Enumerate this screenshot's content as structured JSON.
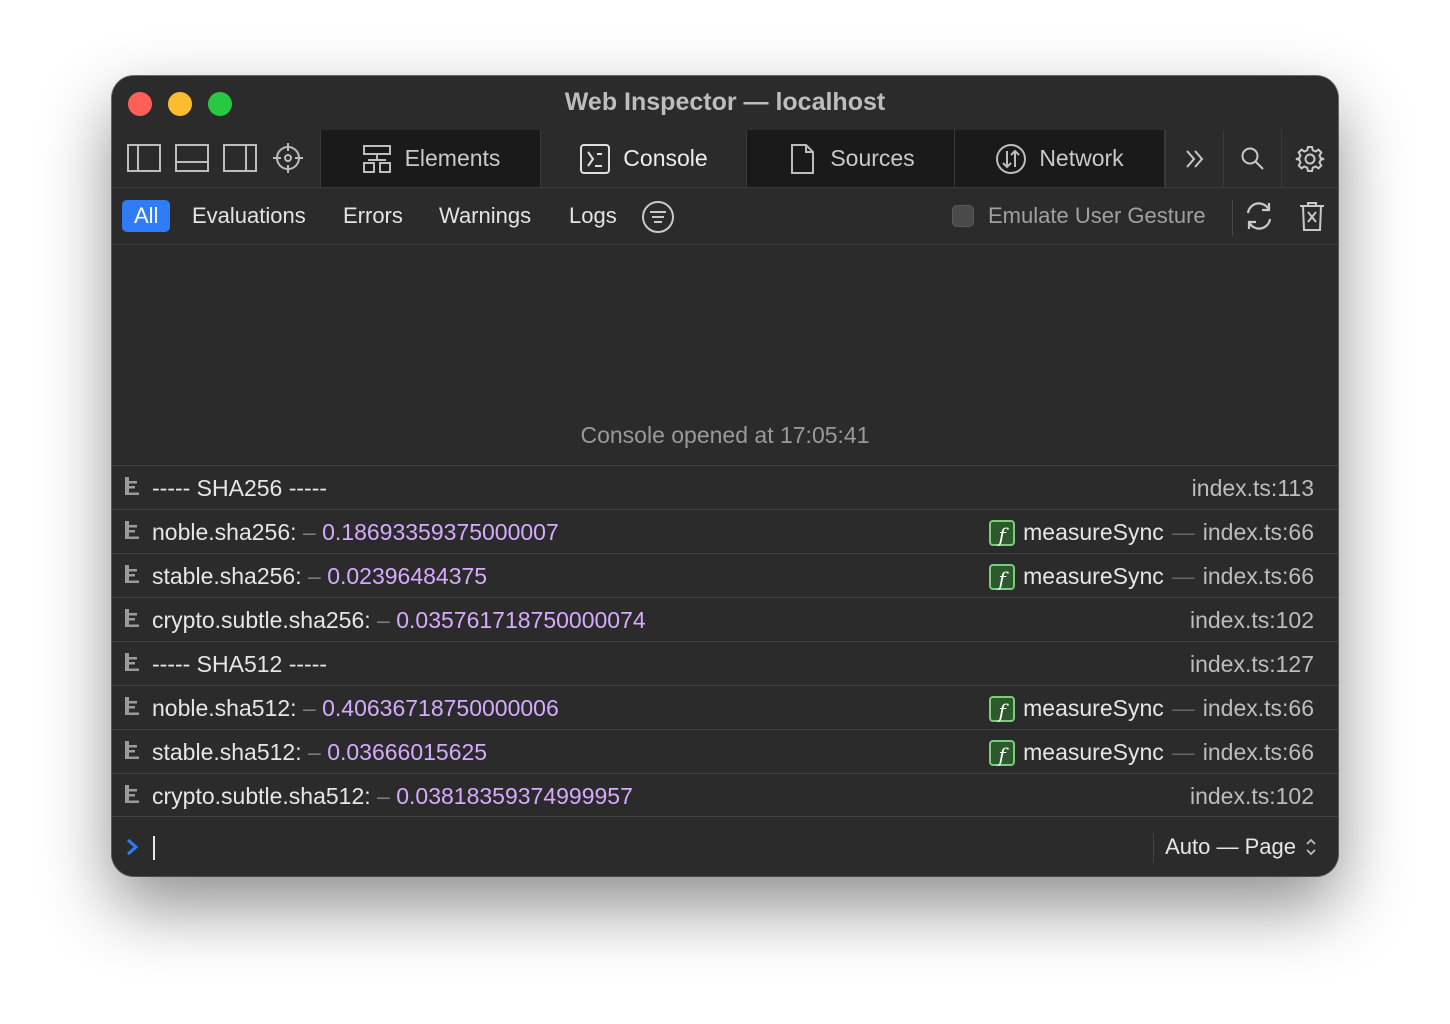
{
  "window": {
    "title": "Web Inspector — localhost"
  },
  "tabs": [
    {
      "label": "Elements",
      "icon": "elements-icon",
      "active": false
    },
    {
      "label": "Console",
      "icon": "console-icon",
      "active": true
    },
    {
      "label": "Sources",
      "icon": "sources-icon",
      "active": false
    },
    {
      "label": "Network",
      "icon": "network-icon",
      "active": false
    }
  ],
  "filters": [
    {
      "label": "All",
      "active": true
    },
    {
      "label": "Evaluations",
      "active": false
    },
    {
      "label": "Errors",
      "active": false
    },
    {
      "label": "Warnings",
      "active": false
    },
    {
      "label": "Logs",
      "active": false
    }
  ],
  "toolbar": {
    "emulate_label": "Emulate User Gesture",
    "emulate_checked": false
  },
  "console": {
    "opened_text": "Console opened at 17:05:41",
    "messages": [
      {
        "text": "----- SHA256 -----",
        "dash": "",
        "value": "",
        "function": "",
        "sep": "",
        "location": "index.ts:113"
      },
      {
        "text": "noble.sha256:",
        "dash": "–",
        "value": "0.18693359375000007",
        "function": "measureSync",
        "sep": "—",
        "location": "index.ts:66"
      },
      {
        "text": "stable.sha256:",
        "dash": "–",
        "value": "0.02396484375",
        "function": "measureSync",
        "sep": "—",
        "location": "index.ts:66"
      },
      {
        "text": "crypto.subtle.sha256:",
        "dash": "–",
        "value": "0.035761718750000074",
        "function": "",
        "sep": "",
        "location": "index.ts:102"
      },
      {
        "text": "----- SHA512 -----",
        "dash": "",
        "value": "",
        "function": "",
        "sep": "",
        "location": "index.ts:127"
      },
      {
        "text": "noble.sha512:",
        "dash": "–",
        "value": "0.40636718750000006",
        "function": "measureSync",
        "sep": "—",
        "location": "index.ts:66"
      },
      {
        "text": "stable.sha512:",
        "dash": "–",
        "value": "0.03666015625",
        "function": "measureSync",
        "sep": "—",
        "location": "index.ts:66"
      },
      {
        "text": "crypto.subtle.sha512:",
        "dash": "–",
        "value": "0.03818359374999957",
        "function": "",
        "sep": "",
        "location": "index.ts:102"
      }
    ]
  },
  "prompt": {
    "context_label": "Auto — Page"
  },
  "colors": {
    "accent": "#2f7df6",
    "number": "#d6aaff",
    "function_badge": "#7ecb7a",
    "traffic_red": "#fe5f57",
    "traffic_yellow": "#febc2e",
    "traffic_green": "#28c840"
  }
}
